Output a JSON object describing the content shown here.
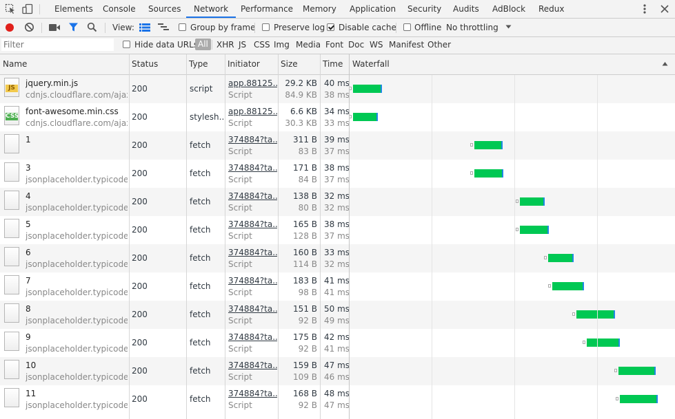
{
  "tabs": [
    {
      "label": "Elements",
      "active": false
    },
    {
      "label": "Console",
      "active": false
    },
    {
      "label": "Sources",
      "active": false
    },
    {
      "label": "Network",
      "active": true
    },
    {
      "label": "Performance",
      "active": false
    },
    {
      "label": "Memory",
      "active": false
    },
    {
      "label": "Application",
      "active": false
    },
    {
      "label": "Security",
      "active": false
    },
    {
      "label": "Audits",
      "active": false
    },
    {
      "label": "AdBlock",
      "active": false
    },
    {
      "label": "Redux",
      "active": false
    }
  ],
  "toolbar": {
    "view_label": "View:",
    "group_by_frame": {
      "label": "Group by frame",
      "checked": false
    },
    "preserve_log": {
      "label": "Preserve log",
      "checked": false
    },
    "disable_cache": {
      "label": "Disable cache",
      "checked": true
    },
    "offline": {
      "label": "Offline",
      "checked": false
    },
    "throttling": "No throttling",
    "record_color": "#e0201b",
    "filter_color": "#1a73e8"
  },
  "filterbar": {
    "placeholder": "Filter",
    "hide_data_urls": {
      "label": "Hide data URLs",
      "checked": false
    },
    "types": [
      "All",
      "XHR",
      "JS",
      "CSS",
      "Img",
      "Media",
      "Font",
      "Doc",
      "WS",
      "Manifest",
      "Other"
    ],
    "active_type": "All"
  },
  "columns": [
    "Name",
    "Status",
    "Type",
    "Initiator",
    "Size",
    "Time",
    "Waterfall"
  ],
  "requests": [
    {
      "name": "jquery.min.js",
      "domain": "cdnjs.cloudflare.com/ajax...",
      "icon": "JS",
      "status": "200",
      "type": "script",
      "initiator": "app.88125...",
      "initiator_sub": "Script",
      "size": "29.2 KB",
      "size_sub": "84.9 KB",
      "time": "40 ms",
      "time_sub": "38 ms",
      "wf_start": 0.011,
      "wf_end": 0.1
    },
    {
      "name": "font-awesome.min.css",
      "domain": "cdnjs.cloudflare.com/ajax...",
      "icon": "CSS",
      "status": "200",
      "type": "stylesh...",
      "initiator": "app.88125...",
      "initiator_sub": "Script",
      "size": "6.6 KB",
      "size_sub": "30.3 KB",
      "time": "34 ms",
      "time_sub": "33 ms",
      "wf_start": 0.011,
      "wf_end": 0.087
    },
    {
      "name": "1",
      "domain": "",
      "icon": "",
      "status": "200",
      "type": "fetch",
      "initiator": "374884?ta...",
      "initiator_sub": "Script",
      "size": "311 B",
      "size_sub": "83 B",
      "time": "39 ms",
      "time_sub": "37 ms",
      "wf_start": 0.384,
      "wf_end": 0.471
    },
    {
      "name": "3",
      "domain": "jsonplaceholder.typicode....",
      "icon": "",
      "status": "200",
      "type": "fetch",
      "initiator": "374884?ta...",
      "initiator_sub": "Script",
      "size": "171 B",
      "size_sub": "84 B",
      "time": "38 ms",
      "time_sub": "37 ms",
      "wf_start": 0.384,
      "wf_end": 0.473
    },
    {
      "name": "4",
      "domain": "jsonplaceholder.typicode....",
      "icon": "",
      "status": "200",
      "type": "fetch",
      "initiator": "374884?ta...",
      "initiator_sub": "Script",
      "size": "138 B",
      "size_sub": "80 B",
      "time": "32 ms",
      "time_sub": "32 ms",
      "wf_start": 0.524,
      "wf_end": 0.599
    },
    {
      "name": "5",
      "domain": "jsonplaceholder.typicode....",
      "icon": "",
      "status": "200",
      "type": "fetch",
      "initiator": "374884?ta...",
      "initiator_sub": "Script",
      "size": "165 B",
      "size_sub": "128 B",
      "time": "38 ms",
      "time_sub": "37 ms",
      "wf_start": 0.524,
      "wf_end": 0.613
    },
    {
      "name": "6",
      "domain": "jsonplaceholder.typicode....",
      "icon": "",
      "status": "200",
      "type": "fetch",
      "initiator": "374884?ta...",
      "initiator_sub": "Script",
      "size": "160 B",
      "size_sub": "114 B",
      "time": "33 ms",
      "time_sub": "32 ms",
      "wf_start": 0.611,
      "wf_end": 0.689
    },
    {
      "name": "7",
      "domain": "jsonplaceholder.typicode....",
      "icon": "",
      "status": "200",
      "type": "fetch",
      "initiator": "374884?ta...",
      "initiator_sub": "Script",
      "size": "183 B",
      "size_sub": "98 B",
      "time": "41 ms",
      "time_sub": "41 ms",
      "wf_start": 0.622,
      "wf_end": 0.72
    },
    {
      "name": "8",
      "domain": "jsonplaceholder.typicode....",
      "icon": "",
      "status": "200",
      "type": "fetch",
      "initiator": "374884?ta...",
      "initiator_sub": "Script",
      "size": "151 B",
      "size_sub": "92 B",
      "time": "50 ms",
      "time_sub": "49 ms",
      "wf_start": 0.696,
      "wf_end": 0.816
    },
    {
      "name": "9",
      "domain": "jsonplaceholder.typicode....",
      "icon": "",
      "status": "200",
      "type": "fetch",
      "initiator": "374884?ta...",
      "initiator_sub": "Script",
      "size": "175 B",
      "size_sub": "92 B",
      "time": "42 ms",
      "time_sub": "41 ms",
      "wf_start": 0.729,
      "wf_end": 0.83
    },
    {
      "name": "10",
      "domain": "jsonplaceholder.typicode....",
      "icon": "",
      "status": "200",
      "type": "fetch",
      "initiator": "374884?ta...",
      "initiator_sub": "Script",
      "size": "159 B",
      "size_sub": "109 B",
      "time": "47 ms",
      "time_sub": "46 ms",
      "wf_start": 0.826,
      "wf_end": 0.941
    },
    {
      "name": "11",
      "domain": "jsonplaceholder.typicode....",
      "icon": "",
      "status": "200",
      "type": "fetch",
      "initiator": "374884?ta...",
      "initiator_sub": "Script",
      "size": "168 B",
      "size_sub": "92 B",
      "time": "48 ms",
      "time_sub": "47 ms",
      "wf_start": 0.831,
      "wf_end": 0.946
    }
  ]
}
